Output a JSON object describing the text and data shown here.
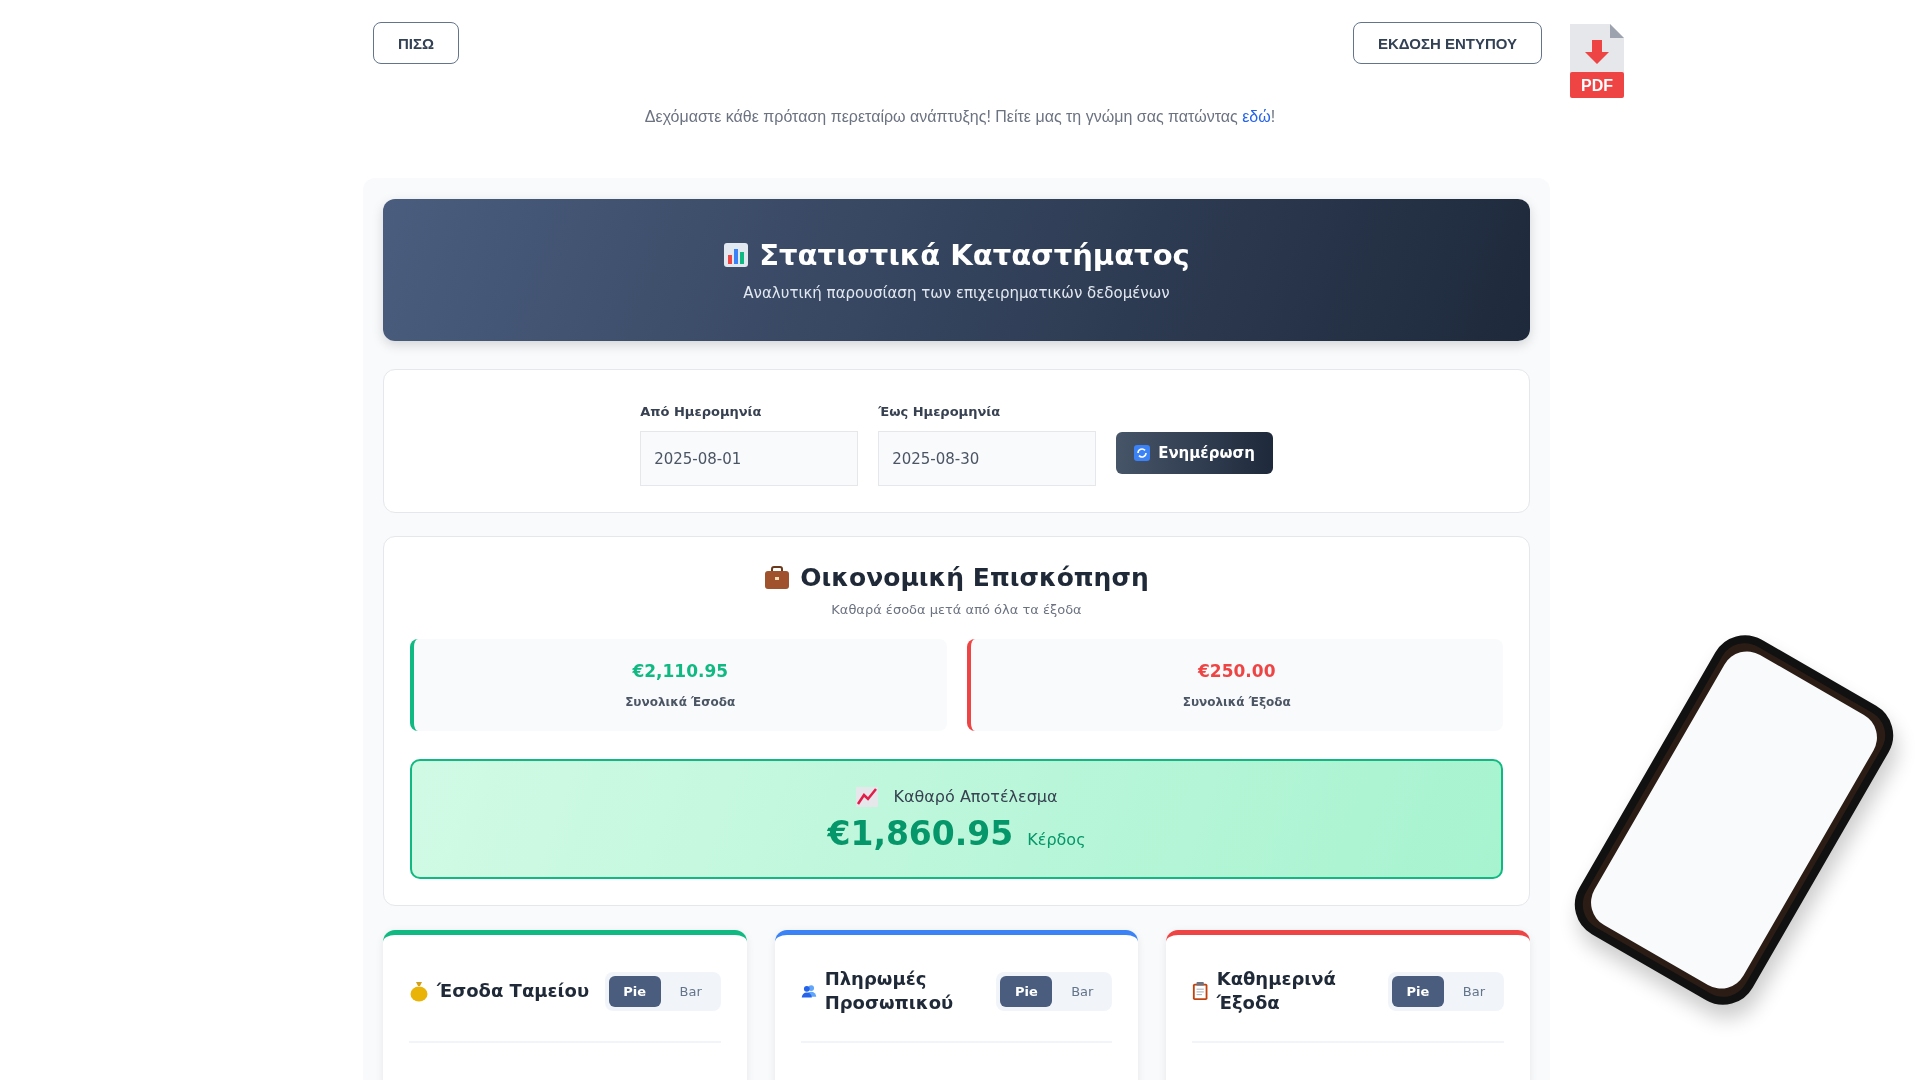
{
  "top_bar": {
    "back_button": "ΠΙΣΩ",
    "print_button": "ΕΚΔΟΣΗ ΕΝΤΥΠΟΥ",
    "pdf_label": "PDF"
  },
  "notice": {
    "text": "Δεχόμαστε κάθε πρόταση περεταίρω ανάπτυξης! Πείτε μας τη γνώμη σας πατώντας ",
    "link": "εδώ",
    "tail": "!"
  },
  "header": {
    "title": "Στατιστικά Καταστήματος",
    "subtitle": "Αναλυτική παρουσίαση των επιχειρηματικών δεδομένων"
  },
  "filters": {
    "fields": [
      {
        "label": "Από Ημερομηνία",
        "value": "2025-08-01"
      },
      {
        "label": "Έως Ημερομηνία",
        "value": "2025-08-30"
      }
    ],
    "button": "Ενημέρωση"
  },
  "overview": {
    "title": "Οικονομική Επισκόπηση",
    "subtitle": "Καθαρά έσοδα μετά από όλα τα έξοδα",
    "stats": [
      {
        "value": "€2,110.95",
        "label": "Συνολικά Έσοδα",
        "color": "#10b981"
      },
      {
        "value": "€250.00",
        "label": "Συνολικά Έξοδα",
        "color": "#ef4444"
      }
    ],
    "net": {
      "label": "Καθαρό Αποτέλεσμα",
      "value": "€1,860.95",
      "status": "Κέρδος"
    }
  },
  "chart_cards": [
    {
      "kind": "money",
      "title": "Έσοδα Ταμείου",
      "color": "#10b981",
      "toggles": [
        {
          "label": "Pie",
          "selected": true
        },
        {
          "label": "Bar",
          "selected": false
        }
      ]
    },
    {
      "kind": "people",
      "title": "Πληρωμές Προσωπικού",
      "color": "#3b82f6",
      "toggles": [
        {
          "label": "Pie",
          "selected": true
        },
        {
          "label": "Bar",
          "selected": false
        }
      ]
    },
    {
      "kind": "clipboard",
      "title": "Καθημερινά Έξοδα",
      "color": "#ef4444",
      "toggles": [
        {
          "label": "Pie",
          "selected": true
        },
        {
          "label": "Bar",
          "selected": false
        }
      ]
    }
  ]
}
